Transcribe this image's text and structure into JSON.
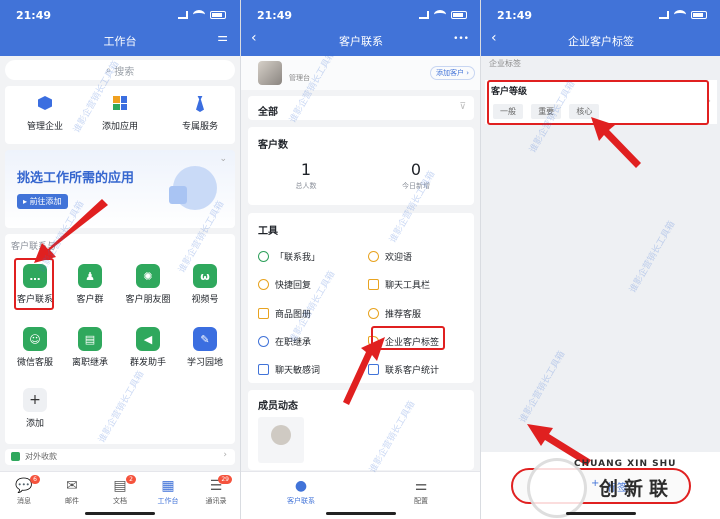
{
  "status": {
    "time": "21:49"
  },
  "screen1": {
    "title": "工作台",
    "search_placeholder": "搜索",
    "top_actions": [
      {
        "label": "管理企业",
        "icon": "hexagon-icon",
        "color": "#3b6ee0"
      },
      {
        "label": "添加应用",
        "icon": "apps-grid-icon",
        "color": "#f0a020"
      },
      {
        "label": "专属服务",
        "icon": "tie-icon",
        "color": "#3b6ee0"
      }
    ],
    "banner": {
      "title": "挑选工作所需的应用",
      "button": "前往添加"
    },
    "section_label": "客户联系与",
    "apps": [
      {
        "label": "客户联系",
        "icon": "chat-bubble-icon",
        "color": "#2fa85d"
      },
      {
        "label": "客户群",
        "icon": "group-icon",
        "color": "#2fa85d"
      },
      {
        "label": "客户朋友圈",
        "icon": "aperture-icon",
        "color": "#2fa85d"
      },
      {
        "label": "视频号",
        "icon": "channels-icon",
        "color": "#2fa85d"
      },
      {
        "label": "微信客服",
        "icon": "service-chat-icon",
        "color": "#2fa85d"
      },
      {
        "label": "离职继承",
        "icon": "document-icon",
        "color": "#2fa85d"
      },
      {
        "label": "群发助手",
        "icon": "megaphone-icon",
        "color": "#2fa85d"
      },
      {
        "label": "学习园地",
        "icon": "learning-icon",
        "color": "#3b6ee0"
      }
    ],
    "add_label": "添加",
    "footer_item": "对外收款",
    "tabs": [
      {
        "label": "消息",
        "glyph": "💬",
        "badge": "6"
      },
      {
        "label": "邮件",
        "glyph": "✉",
        "badge": ""
      },
      {
        "label": "文档",
        "glyph": "▤",
        "badge": "2"
      },
      {
        "label": "工作台",
        "glyph": "▦",
        "badge": ""
      },
      {
        "label": "通讯录",
        "glyph": "☰",
        "badge": "29"
      }
    ]
  },
  "screen2": {
    "title": "客户联系",
    "more": "•••",
    "profile_name": "管理台",
    "add_customer": "添加客户",
    "filter": "全部",
    "count_title": "客户数",
    "stats": [
      {
        "value": "1",
        "label": "总人数"
      },
      {
        "value": "0",
        "label": "今日新增"
      }
    ],
    "tools_title": "工具",
    "tools": [
      "「联系我」",
      "欢迎语",
      "快捷回复",
      "聊天工具栏",
      "商品图册",
      "推荐客服",
      "在职继承",
      "企业客户标签",
      "聊天敏感词",
      "联系客户统计"
    ],
    "members_title": "成员动态",
    "tab_left": "客户联系",
    "tab_right": "配置"
  },
  "screen3": {
    "title": "企业客户标签",
    "section": "企业标签",
    "group_name": "客户等级",
    "tags": [
      "一般",
      "重要",
      "核心"
    ],
    "add_button": "标签",
    "brand_top": "CHUANG XIN SHU",
    "brand_bottom": "创新联"
  },
  "watermark_text": "谁影企营销长工具箱"
}
